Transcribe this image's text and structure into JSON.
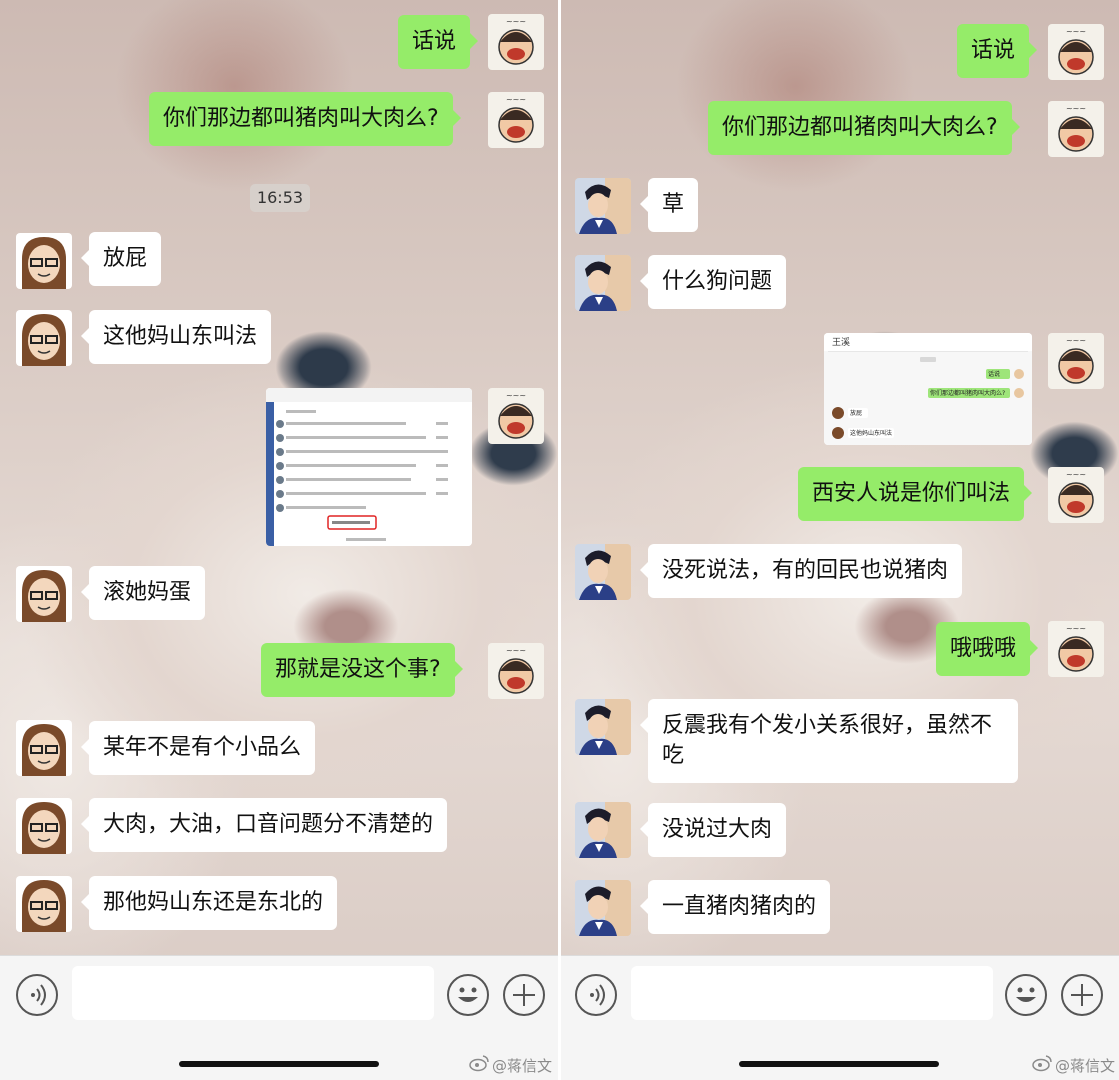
{
  "left": {
    "time": "16:53",
    "messages": [
      {
        "side": "out",
        "text": "话说"
      },
      {
        "side": "out",
        "text": "你们那边都叫猪肉叫大肉么?"
      },
      {
        "side": "in",
        "text": "放屁"
      },
      {
        "side": "in",
        "text": "这他妈山东叫法"
      },
      {
        "side": "out",
        "type": "image",
        "image_label": "screenshot-comments"
      },
      {
        "side": "in",
        "text": "滚她妈蛋"
      },
      {
        "side": "out",
        "text": "那就是没这个事?"
      },
      {
        "side": "in",
        "text": "某年不是有个小品么"
      },
      {
        "side": "in",
        "text": "大肉，大油，口音问题分不清楚的"
      },
      {
        "side": "in",
        "text": "那他妈山东还是东北的"
      }
    ]
  },
  "right": {
    "messages": [
      {
        "side": "out",
        "text": "话说"
      },
      {
        "side": "out",
        "text": "你们那边都叫猪肉叫大肉么?"
      },
      {
        "side": "in",
        "text": "草"
      },
      {
        "side": "in",
        "text": "什么狗问题"
      },
      {
        "side": "out",
        "type": "image",
        "image_label": "screenshot-chat"
      },
      {
        "side": "out",
        "text": "西安人说是你们叫法"
      },
      {
        "side": "in",
        "text": "没死说法，有的回民也说猪肉"
      },
      {
        "side": "out",
        "text": "哦哦哦"
      },
      {
        "side": "in",
        "text": "反震我有个发小关系很好，虽然不\n吃"
      },
      {
        "side": "in",
        "text": "没说过大肉"
      },
      {
        "side": "in",
        "text": "一直猪肉猪肉的"
      }
    ],
    "embedded_chat": {
      "title": "王溪",
      "rows": [
        "话说",
        "你们那边都叫猪肉叫大肉么?",
        "放屁",
        "这他妈山东叫法"
      ]
    }
  },
  "input_bar": {
    "placeholder": ""
  },
  "watermark": "@蒋信文",
  "colors": {
    "out_bubble": "#95ec69",
    "in_bubble": "#ffffff",
    "input_bar": "#f5f5f5"
  },
  "icons": [
    "voice-icon",
    "emoji-icon",
    "plus-icon",
    "weibo-icon"
  ]
}
